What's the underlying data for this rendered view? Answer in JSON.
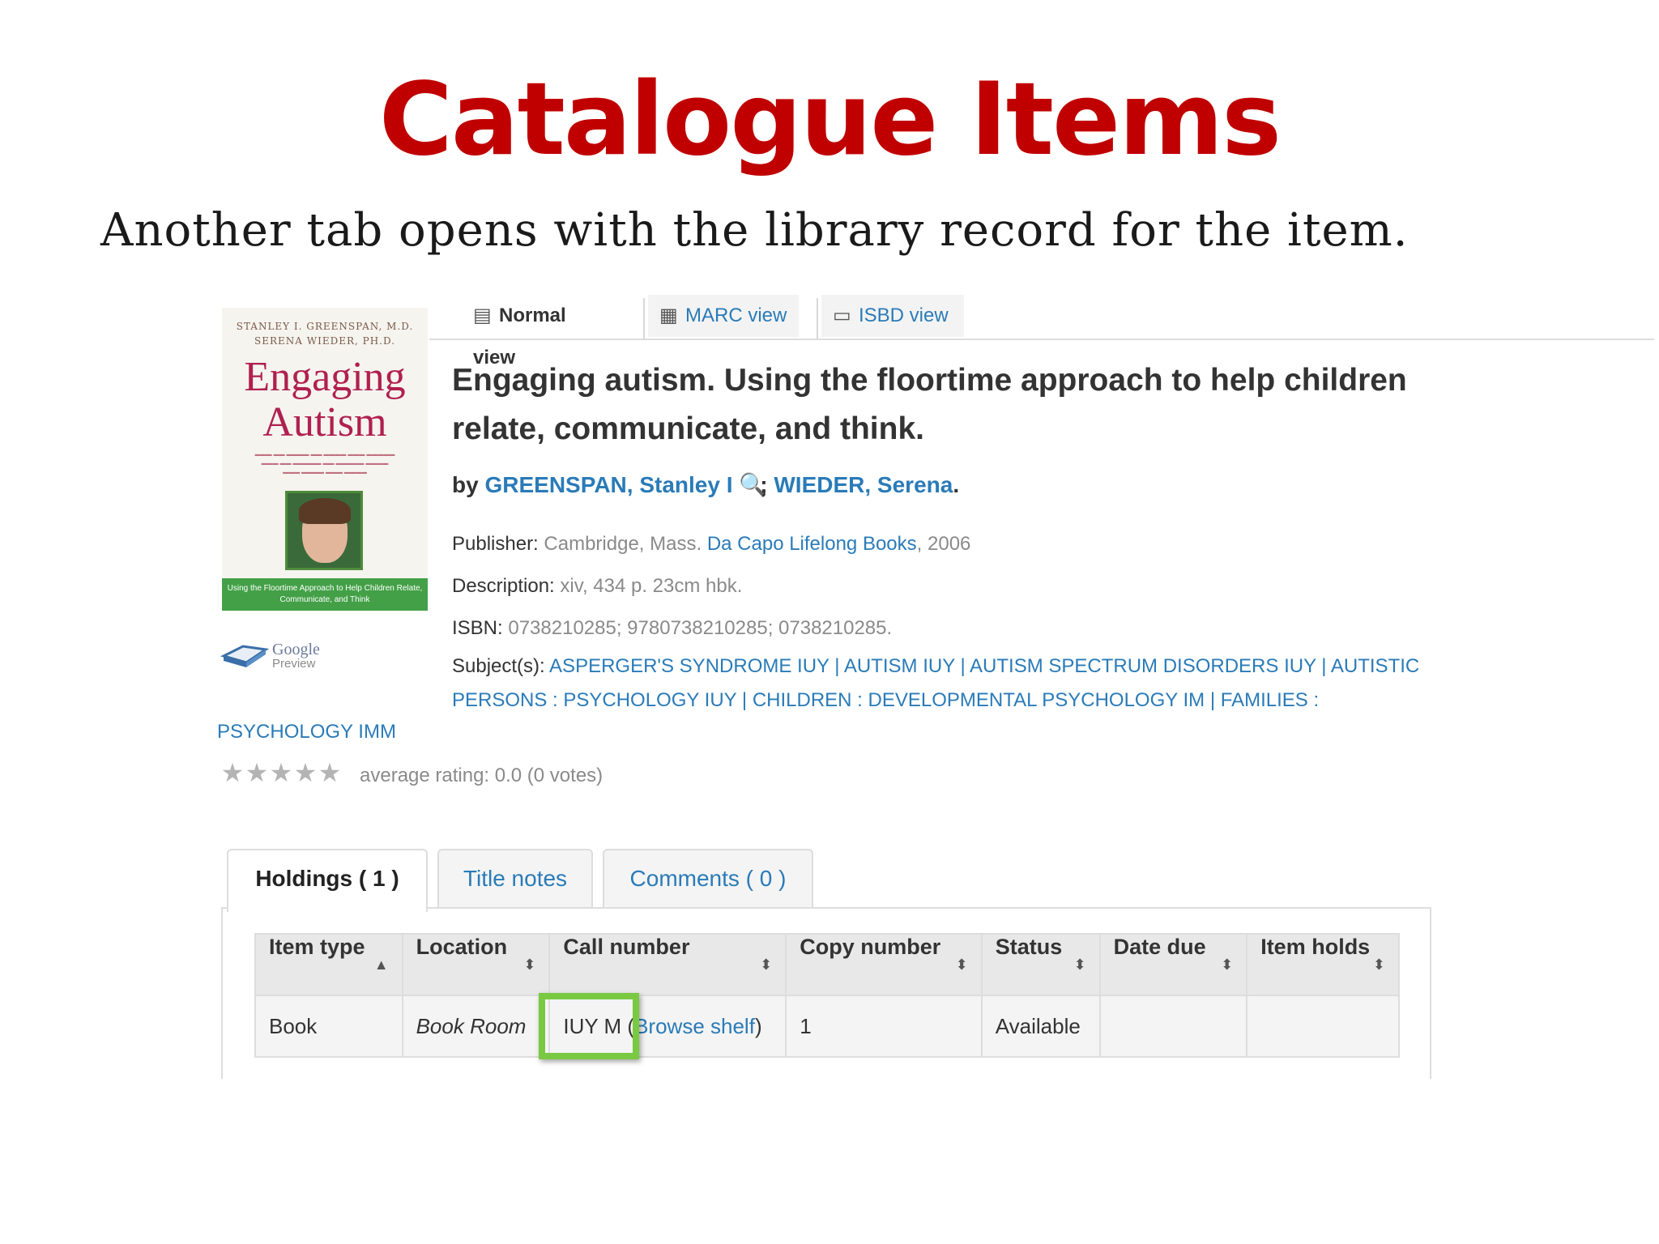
{
  "slide": {
    "title": "Catalogue Items",
    "subtitle": "Another tab opens with the library record for the item."
  },
  "cover": {
    "authors_line1": "STANLEY I. GREENSPAN, M.D.",
    "authors_line2": "SERENA WIEDER, PH.D.",
    "title_line1": "Engaging",
    "title_line2": "Autism",
    "band_text": "Using the Floortime Approach to Help Children Relate, Communicate, and Think"
  },
  "google_preview": {
    "brand": "Google",
    "label": "Preview"
  },
  "view_tabs": [
    {
      "label": "Normal view",
      "icon": "document-icon",
      "active": true
    },
    {
      "label": "MARC view",
      "icon": "list-icon",
      "active": false
    },
    {
      "label": "ISBD view",
      "icon": "folder-icon",
      "active": false
    }
  ],
  "record": {
    "title": "Engaging autism. Using the floortime approach to help children relate, communicate, and think.",
    "by_label": "by",
    "author1": "GREENSPAN, Stanley I",
    "separator": ";",
    "author2": "WIEDER, Serena",
    "period": ".",
    "publisher_label": "Publisher:",
    "publisher_place": "Cambridge, Mass.",
    "publisher_name": "Da Capo Lifelong Books",
    "publisher_year": ", 2006",
    "description_label": "Description:",
    "description": "xiv, 434 p. 23cm hbk.",
    "isbn_label": "ISBN:",
    "isbn": "0738210285; 9780738210285; 0738210285.",
    "subjects_label": "Subject(s):",
    "subjects": [
      "ASPERGER'S SYNDROME IUY",
      "AUTISM IUY",
      "AUTISM SPECTRUM DISORDERS IUY",
      "AUTISTIC PERSONS : PSYCHOLOGY IUY",
      "CHILDREN : DEVELOPMENTAL PSYCHOLOGY IM",
      "FAMILIES :"
    ],
    "subjects_wrap": "PSYCHOLOGY IMM"
  },
  "rating": {
    "stars_filled": 0,
    "stars_total": 5,
    "text": "average rating: 0.0 (0 votes)"
  },
  "holdings_tabs": [
    {
      "label": "Holdings ( 1 )",
      "active": true
    },
    {
      "label": "Title notes",
      "active": false
    },
    {
      "label": "Comments ( 0 )",
      "active": false
    }
  ],
  "table": {
    "headers": [
      "Item type",
      "Location",
      "Call number",
      "Copy number",
      "Status",
      "Date due",
      "Item holds"
    ],
    "sort_icons": [
      "sort-asc-icon",
      "sort-both-icon",
      "sort-both-icon",
      "sort-both-icon",
      "sort-both-icon",
      "sort-both-icon",
      "sort-both-icon"
    ],
    "row": {
      "item_type": "Book",
      "location": "Book Room",
      "call_number": "IUY M",
      "browse_open": "(",
      "browse_shelf": "Browse shelf",
      "browse_close": ")",
      "copy_number": "1",
      "status": "Available",
      "date_due": "",
      "item_holds": ""
    }
  },
  "colors": {
    "title_red": "#c00000",
    "link_blue": "#2a7bb8",
    "highlight_green": "#7ac943",
    "cover_green": "#43a047"
  }
}
